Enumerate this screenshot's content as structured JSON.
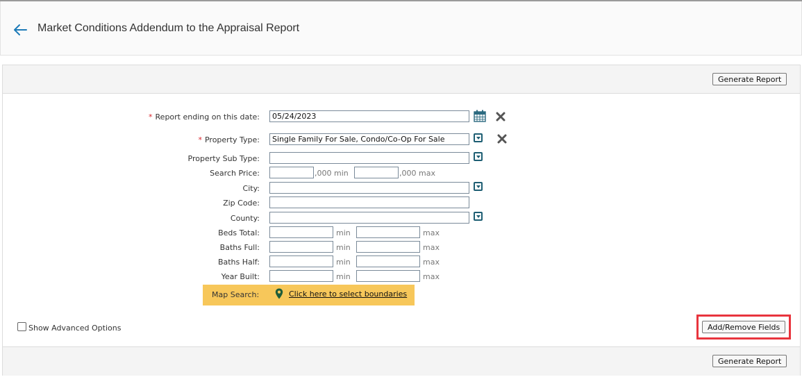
{
  "header": {
    "title": "Market Conditions Addendum to the Appraisal Report"
  },
  "actions": {
    "generate_report": "Generate Report",
    "add_remove_fields": "Add/Remove Fields"
  },
  "form": {
    "required_marker": "*",
    "report_ending": {
      "label": "Report ending on this date:",
      "value": "05/24/2023"
    },
    "property_type": {
      "label": "Property Type:",
      "value": "Single Family For Sale, Condo/Co-Op For Sale"
    },
    "property_sub_type": {
      "label": "Property Sub Type:",
      "value": ""
    },
    "search_price": {
      "label": "Search Price:",
      "min_suffix": ",000 min",
      "max_suffix": ",000 max"
    },
    "city": {
      "label": "City:",
      "value": ""
    },
    "zip_code": {
      "label": "Zip Code:",
      "value": ""
    },
    "county": {
      "label": "County:",
      "value": ""
    },
    "beds_total": {
      "label": "Beds Total:"
    },
    "baths_full": {
      "label": "Baths Full:"
    },
    "baths_half": {
      "label": "Baths Half:"
    },
    "year_built": {
      "label": "Year Built:"
    },
    "min_label": "min",
    "max_label": "max"
  },
  "map_search": {
    "label": "Map Search:",
    "link": "Click here to select boundaries"
  },
  "advanced": {
    "label": "Show Advanced Options",
    "checked": false
  },
  "colors": {
    "accent": "#1d7bb8",
    "highlight": "#e8343d",
    "map_bg": "#f7c75a"
  }
}
